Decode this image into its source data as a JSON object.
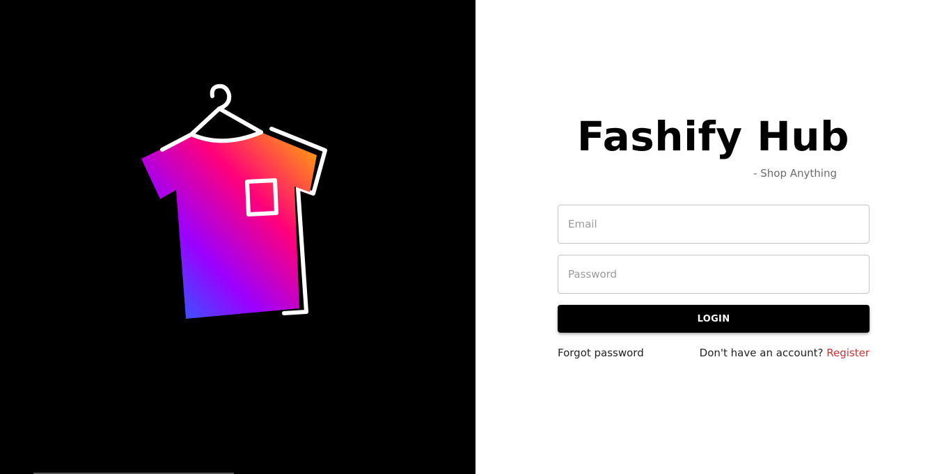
{
  "brand": {
    "title": "Fashify Hub",
    "tagline": "- Shop Anything",
    "logo_icon": "tshirt-hanger-icon"
  },
  "login_form": {
    "email_placeholder": "Email",
    "password_placeholder": "Password",
    "login_label": "LOGIN",
    "forgot_password_label": "Forgot password",
    "no_account_text": "Don't have an account?",
    "register_label": "Register"
  },
  "colors": {
    "left_background": "#000000",
    "right_background": "#ffffff",
    "button_background": "#000000",
    "register_link": "#d32f2f",
    "logo_gradient": [
      "#0b7cff",
      "#9b00ff",
      "#ff007a",
      "#ffb000"
    ]
  }
}
